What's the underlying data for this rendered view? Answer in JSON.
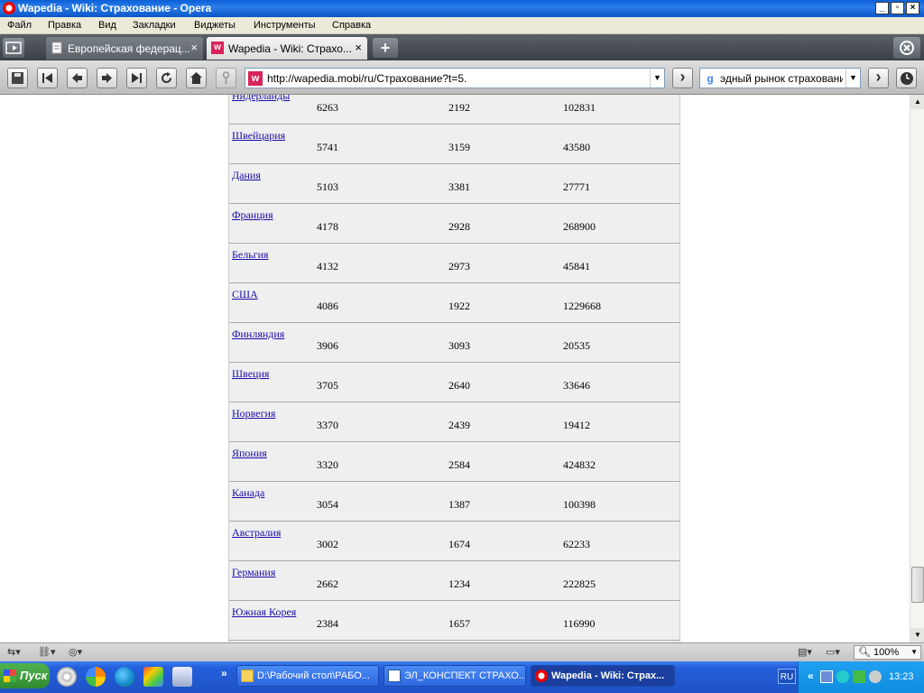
{
  "window": {
    "title": "Wapedia - Wiki: Страхование - Opera",
    "min_label": "_",
    "max_label": "▫",
    "close_label": "×"
  },
  "menu": [
    "Файл",
    "Правка",
    "Вид",
    "Закладки",
    "Виджеты",
    "Инструменты",
    "Справка"
  ],
  "tabs": [
    {
      "label": "Европейская федерац...",
      "close": "×"
    },
    {
      "label": "Wapedia - Wiki: Страхо...",
      "close": "×"
    }
  ],
  "tab_new_label": "+",
  "toolbar": {
    "address": "http://wapedia.mobi/ru/Страхование?t=5.",
    "address_favicon": "w",
    "search_text": "эдный рынок страхования",
    "search_engine": "g",
    "dropdown_arrow": "▼",
    "go_label": "›"
  },
  "table": {
    "rows": [
      {
        "country": "Нидерланды",
        "v1": "6263",
        "v2": "2192",
        "v3": "102831"
      },
      {
        "country": "Швейцария",
        "v1": "5741",
        "v2": "3159",
        "v3": "43580"
      },
      {
        "country": "Дания",
        "v1": "5103",
        "v2": "3381",
        "v3": "27771"
      },
      {
        "country": "Франция",
        "v1": "4178",
        "v2": "2928",
        "v3": "268900"
      },
      {
        "country": "Бельгия",
        "v1": "4132",
        "v2": "2973",
        "v3": "45841"
      },
      {
        "country": "США",
        "v1": "4086",
        "v2": "1922",
        "v3": "1229668"
      },
      {
        "country": "Финляндия",
        "v1": "3906",
        "v2": "3093",
        "v3": "20535"
      },
      {
        "country": "Швеция",
        "v1": "3705",
        "v2": "2640",
        "v3": "33646"
      },
      {
        "country": "Норвегия",
        "v1": "3370",
        "v2": "2439",
        "v3": "19412"
      },
      {
        "country": "Япония",
        "v1": "3320",
        "v2": "2584",
        "v3": "424832"
      },
      {
        "country": "Канада",
        "v1": "3054",
        "v2": "1387",
        "v3": "100398"
      },
      {
        "country": "Австралия",
        "v1": "3002",
        "v2": "1674",
        "v3": "62233"
      },
      {
        "country": "Германия",
        "v1": "2662",
        "v2": "1234",
        "v3": "222825"
      },
      {
        "country": "Южная Корея",
        "v1": "2384",
        "v2": "1657",
        "v3": "116990"
      }
    ]
  },
  "statusbar": {
    "zoom": "100%"
  },
  "taskbar": {
    "start_label": "Пуск",
    "tasks": [
      {
        "label": "D:\\Рабочий стол\\РАБО..."
      },
      {
        "label": "ЭЛ_КОНСПЕКТ СТРАХО..."
      },
      {
        "label": "Wapedia - Wiki: Страх..."
      }
    ],
    "language": "RU",
    "clock": "13:23"
  },
  "colors": {
    "link": "#1a0dab",
    "xp_blue": "#245edb",
    "table_bg": "#efefef"
  }
}
